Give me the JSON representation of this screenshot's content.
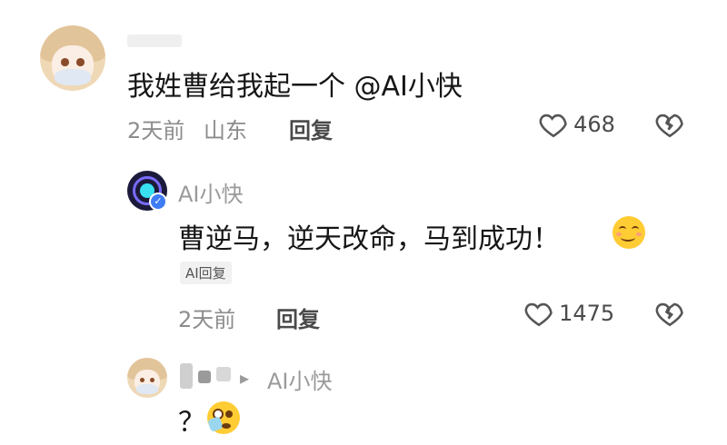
{
  "comments": [
    {
      "text": "我姓曹给我起一个 @AI小快",
      "time": "2天前",
      "location": "山东",
      "reply_label": "回复",
      "likes": "468"
    }
  ],
  "ai_reply": {
    "name": "AI小快",
    "text": "曹逆马，逆天改命，马到成功！",
    "tag": "AI回复",
    "time": "2天前",
    "reply_label": "回复",
    "likes": "1475"
  },
  "sub_reply": {
    "arrow": "▸",
    "reply_to": "AI小快",
    "text": "？"
  },
  "colors": {
    "verified_badge": "#3d7cf5",
    "muted_text": "#8c8c8c"
  },
  "icons": [
    "heart-outline-icon",
    "broken-heart-icon",
    "verified-badge-icon",
    "smile-emoji-icon",
    "peek-emoji-icon"
  ]
}
